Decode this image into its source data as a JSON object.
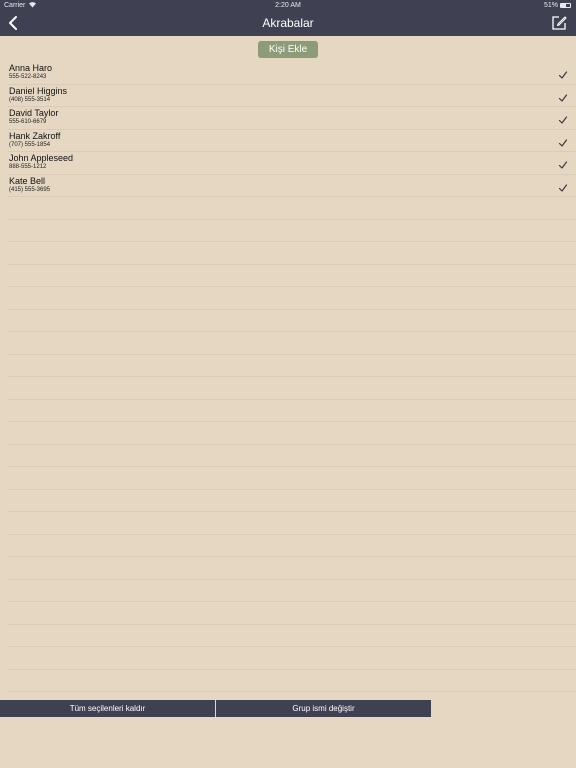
{
  "status": {
    "carrier": "Carrier",
    "time": "2:20 AM",
    "battery": "51%",
    "battery_level": 0.51,
    "wifi_icon": "wifi-icon"
  },
  "nav": {
    "title": "Akrabalar",
    "back_icon": "chevron-left-icon",
    "edit_icon": "compose-icon"
  },
  "add_button": "Kişi Ekle",
  "contacts": [
    {
      "name": "Anna Haro",
      "phone": "555-522-8243",
      "checked": true
    },
    {
      "name": "Daniel Higgins",
      "phone": "(408) 555-3514",
      "checked": true
    },
    {
      "name": "David Taylor",
      "phone": "555-610-6679",
      "checked": true
    },
    {
      "name": "Hank Zakroff",
      "phone": "(707) 555-1854",
      "checked": true
    },
    {
      "name": "John Appleseed",
      "phone": "888-555-1212",
      "checked": true
    },
    {
      "name": "Kate Bell",
      "phone": "(415) 555-3695",
      "checked": true
    }
  ],
  "toolbar": {
    "deselect_all": "Tüm seçilenleri kaldır",
    "rename_group": "Grup ismi değiştir"
  },
  "colors": {
    "bar": "#3f4152",
    "background": "#e5d7c2",
    "button": "#8c9c78",
    "separator": "#d9cbb6"
  }
}
